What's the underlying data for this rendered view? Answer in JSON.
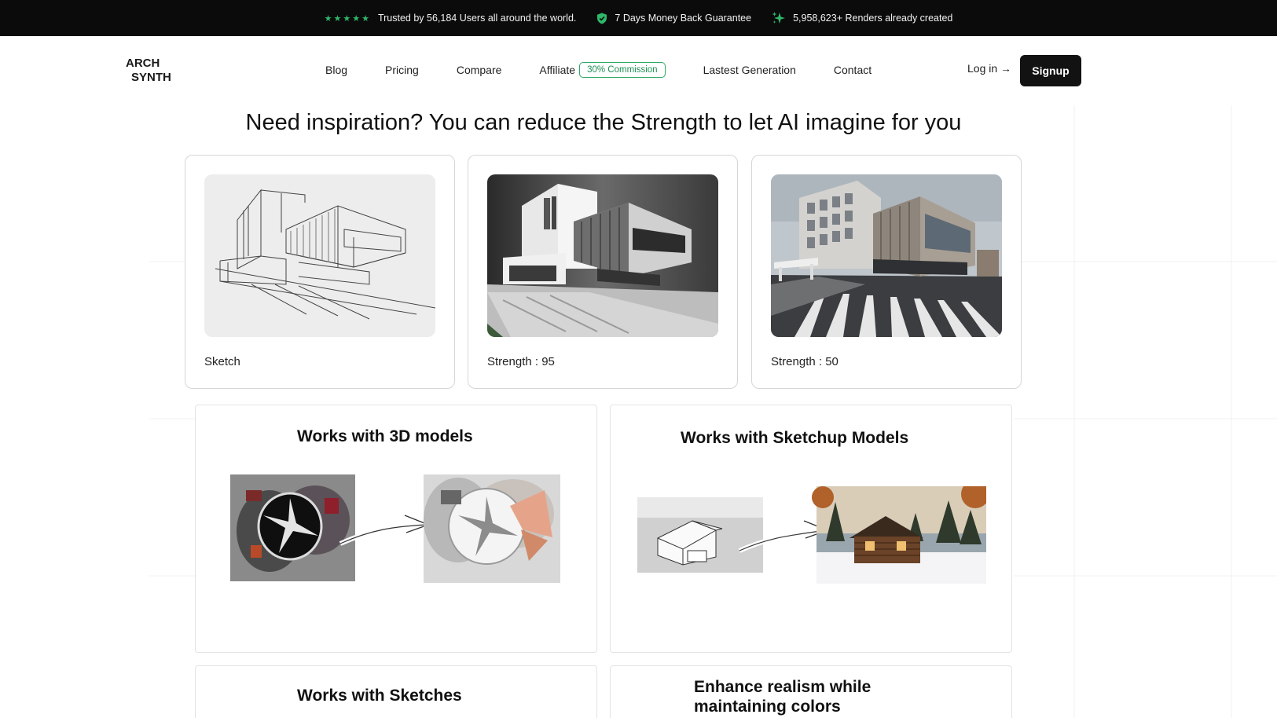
{
  "banner": {
    "trust_text": "Trusted by 56,184 Users all around the world.",
    "guarantee_text": "7 Days Money Back Guarantee",
    "renders_text": "5,958,623+ Renders already created",
    "stars": "★★★★★",
    "accent_color": "#2fb86a"
  },
  "logo": {
    "line1": "ARCH",
    "line2": "SYNTH"
  },
  "nav": {
    "blog": "Blog",
    "pricing": "Pricing",
    "compare": "Compare",
    "affiliate": "Affiliate",
    "affiliate_badge": "30% Commission",
    "latest": "Lastest Generation",
    "contact": "Contact",
    "login": "Log in →",
    "signup": "Signup"
  },
  "headline": "Need inspiration? You can reduce the Strength to let AI imagine for you",
  "cards": [
    {
      "caption": "Sketch",
      "image": "building-sketch"
    },
    {
      "caption": "Strength : 95",
      "image": "building-render-grayscale"
    },
    {
      "caption": "Strength : 50",
      "image": "building-render-street"
    }
  ],
  "panels": {
    "models_3d": "Works with 3D  models",
    "sketchup": "Works with Sketchup Models",
    "sketches": "Works with Sketches",
    "realism_line1": "Enhance realism while",
    "realism_line2": "maintaining colors"
  }
}
